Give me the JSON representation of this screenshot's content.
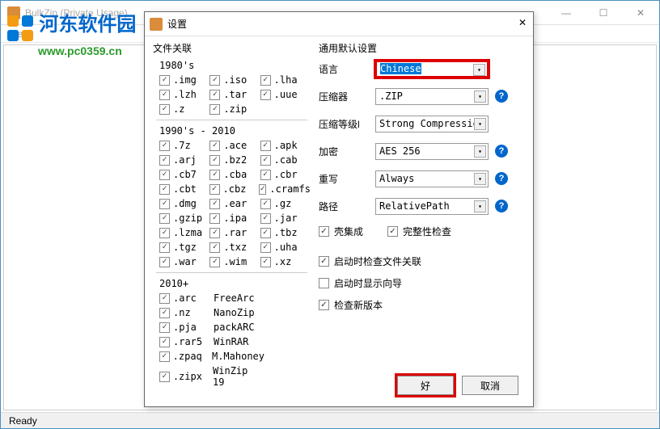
{
  "mainWindow": {
    "title": "BulkZip (Private Usage)",
    "menu": "File",
    "status": "Ready"
  },
  "watermark": {
    "text": "河东软件园",
    "url": "www.pc0359.cn"
  },
  "dialog": {
    "title": "设置",
    "leftLabel": "文件关联",
    "rightLabel": "通用默认设置",
    "era1": "1980's",
    "era2": "1990's - 2010",
    "era3": "2010+",
    "g1980": [
      [
        ".img",
        ".iso",
        ".lha"
      ],
      [
        ".lzh",
        ".tar",
        ".uue"
      ],
      [
        ".z",
        ".zip",
        ""
      ]
    ],
    "g1990": [
      [
        ".7z",
        ".ace",
        ".apk"
      ],
      [
        ".arj",
        ".bz2",
        ".cab"
      ],
      [
        ".cb7",
        ".cba",
        ".cbr"
      ],
      [
        ".cbt",
        ".cbz",
        ".cramfs"
      ],
      [
        ".dmg",
        ".ear",
        ".gz"
      ],
      [
        ".gzip",
        ".ipa",
        ".jar"
      ],
      [
        ".lzma",
        ".rar",
        ".tbz"
      ],
      [
        ".tgz",
        ".txz",
        ".uha"
      ],
      [
        ".war",
        ".wim",
        ".xz"
      ]
    ],
    "g2010": [
      [
        ".arc",
        "FreeArc"
      ],
      [
        ".nz",
        "NanoZip"
      ],
      [
        ".pja",
        "packARC"
      ],
      [
        ".rar5",
        "WinRAR"
      ],
      [
        ".zpaq",
        "M.Mahoney"
      ],
      [
        ".zipx",
        "WinZip 19"
      ]
    ],
    "settings": {
      "lang": {
        "label": "语言",
        "value": "Chinese"
      },
      "compressor": {
        "label": "压缩器",
        "value": ".ZIP"
      },
      "level": {
        "label": "压缩等级l",
        "value": "Strong Compression"
      },
      "encrypt": {
        "label": "加密",
        "value": "AES 256"
      },
      "rewrite": {
        "label": "重写",
        "value": "Always"
      },
      "path": {
        "label": "路径",
        "value": "RelativePath"
      }
    },
    "options": {
      "shell": "壳集成",
      "integrity": "完整性检查",
      "checkAssoc": "启动时检查文件关联",
      "showWizard": "启动时显示向导",
      "checkUpdate": "检查新版本"
    },
    "buttons": {
      "ok": "好",
      "cancel": "取消"
    }
  }
}
